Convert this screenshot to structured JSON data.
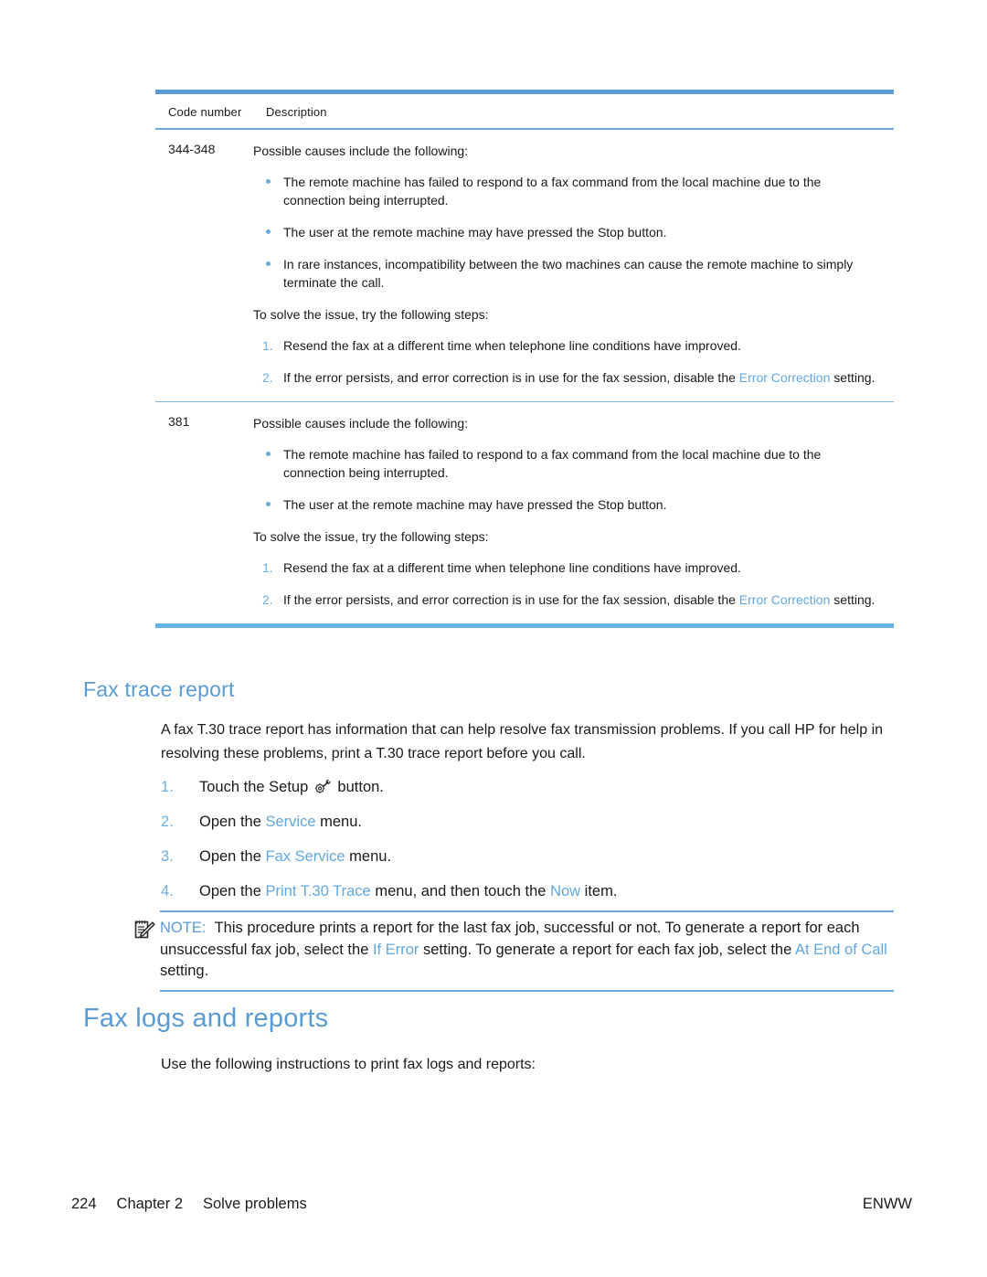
{
  "table": {
    "headers": {
      "code": "Code number",
      "description": "Description"
    },
    "rows": [
      {
        "code": "344-348",
        "lead": "Possible causes include the following:",
        "bullets": [
          "The remote machine has failed to respond to a fax command from the local machine due to the connection being interrupted.",
          "The user at the remote machine may have pressed the Stop button.",
          "In rare instances, incompatibility between the two machines can cause the remote machine to simply terminate the call."
        ],
        "steps_lead": "To solve the issue, try the following steps:",
        "steps": [
          {
            "pre": "Resend the fax at a different time when telephone line conditions have improved.",
            "link": "",
            "post": ""
          },
          {
            "pre": "If the error persists, and error correction is in use for the fax session, disable the ",
            "link": "Error Correction",
            "post": " setting."
          }
        ]
      },
      {
        "code": "381",
        "lead": "Possible causes include the following:",
        "bullets": [
          "The remote machine has failed to respond to a fax command from the local machine due to the connection being interrupted.",
          "The user at the remote machine may have pressed the Stop button."
        ],
        "steps_lead": "To solve the issue, try the following steps:",
        "steps": [
          {
            "pre": "Resend the fax at a different time when telephone line conditions have improved.",
            "link": "",
            "post": ""
          },
          {
            "pre": "If the error persists, and error correction is in use for the fax session, disable the ",
            "link": "Error Correction",
            "post": " setting."
          }
        ]
      }
    ]
  },
  "fax_trace": {
    "heading": "Fax trace report",
    "paragraph": "A fax T.30 trace report has information that can help resolve fax transmission problems. If you call HP for help in resolving these problems, print a T.30 trace report before you call.",
    "steps": [
      {
        "pre": "Touch the Setup ",
        "icon": "gear-wrench-icon",
        "post": " button."
      },
      {
        "pre": "Open the ",
        "link": "Service",
        "post": " menu."
      },
      {
        "pre": "Open the ",
        "link": "Fax Service",
        "post": " menu."
      },
      {
        "pre": "Open the ",
        "link": "Print T.30 Trace",
        "mid": " menu, and then touch the ",
        "link2": "Now",
        "post": " item."
      }
    ]
  },
  "note": {
    "icon": "note-pencil-icon",
    "label": "NOTE:",
    "text_1": "This procedure prints a report for the last fax job, successful or not. To generate a report for each unsuccessful fax job, select the ",
    "link_1": "If Error",
    "text_2": " setting. To generate a report for each fax job, select the ",
    "link_2": "At End of Call",
    "text_3": " setting."
  },
  "fax_logs": {
    "heading": "Fax logs and reports",
    "paragraph": "Use the following instructions to print fax logs and reports:"
  },
  "footer": {
    "page_number": "224",
    "chapter": "Chapter 2",
    "chapter_title": "Solve problems",
    "locale": "ENWW"
  },
  "colors": {
    "accent_blue": "#5b9bd5",
    "link_blue": "#61a8e0",
    "rule_blue": "#6aaade"
  }
}
